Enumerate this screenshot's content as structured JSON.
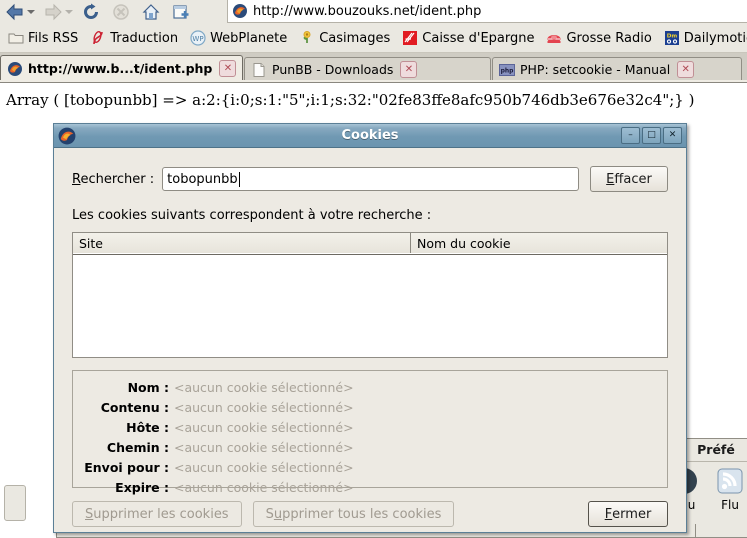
{
  "browser": {
    "nav": {
      "back": "back-arrow",
      "back_menu": "back-dropdown",
      "forward": "forward-arrow",
      "forward_menu": "forward-dropdown",
      "reload": "reload-icon",
      "stop": "stop-icon",
      "home": "home-icon",
      "newtab": "new-tab-icon"
    },
    "url": {
      "value": "http://www.bouzouks.net/ident.php",
      "favicon": "firefox-favicon"
    },
    "bookmarks": [
      {
        "label": "Fils RSS",
        "icon": "folder-icon"
      },
      {
        "label": "Traduction",
        "icon": "traduction-icon"
      },
      {
        "label": "WebPlanete",
        "icon": "webplanete-icon"
      },
      {
        "label": "Casimages",
        "icon": "casimages-icon"
      },
      {
        "label": "Caisse d'Epargne",
        "icon": "caisse-epargne-icon"
      },
      {
        "label": "Grosse Radio",
        "icon": "grosse-radio-icon"
      },
      {
        "label": "Dailymotion",
        "icon": "dailymotion-icon"
      }
    ],
    "tabs": [
      {
        "label": "http://www.b...t/ident.php",
        "icon": "firefox-favicon",
        "active": true,
        "close": "✕"
      },
      {
        "label": "PunBB - Downloads",
        "icon": "page-icon",
        "active": false,
        "close": "✕"
      },
      {
        "label": "PHP: setcookie - Manual",
        "icon": "php-icon",
        "active": false,
        "close": "✕"
      }
    ],
    "page_text": "Array ( [tobopunbb] => a:2:{i:0;s:1:\"5\";i:1;s:32:\"02fe83ffe8afc950b746db3e676e32c4\";} )"
  },
  "prefs_window": {
    "title": "Préfé",
    "cells": [
      {
        "label": "enu",
        "icon": "menu-icon"
      },
      {
        "label": "Flu",
        "icon": "feed-icon"
      }
    ]
  },
  "dialog": {
    "title": "Cookies",
    "icon": "firefox-icon",
    "window_buttons": {
      "minimize": "–",
      "maximize": "□",
      "close": "✕"
    },
    "search": {
      "label_prefix": "R",
      "label_rest": "echercher :",
      "value": "tobopunbb",
      "placeholder": "",
      "clear_prefix": "E",
      "clear_rest": "ffacer"
    },
    "hint": "Les cookies suivants correspondent à votre recherche :",
    "list": {
      "columns": [
        "Site",
        "Nom du cookie"
      ],
      "rows": []
    },
    "details": {
      "empty_value": "<aucun cookie sélectionné>",
      "fields": [
        {
          "label": "Nom :",
          "value": "<aucun cookie sélectionné>"
        },
        {
          "label": "Contenu :",
          "value": "<aucun cookie sélectionné>"
        },
        {
          "label": "Hôte :",
          "value": "<aucun cookie sélectionné>"
        },
        {
          "label": "Chemin :",
          "value": "<aucun cookie sélectionné>"
        },
        {
          "label": "Envoi pour :",
          "value": "<aucun cookie sélectionné>"
        },
        {
          "label": "Expire :",
          "value": "<aucun cookie sélectionné>"
        }
      ]
    },
    "buttons": {
      "delete_prefix": "S",
      "delete_rest": "upprimer les cookies",
      "delete_all_prefix": "S",
      "delete_all_mid": "u",
      "delete_all_rest": "pprimer tous les cookies",
      "close_prefix": "F",
      "close_rest": "ermer"
    }
  },
  "colors": {
    "titlebar": "#7099b3",
    "dialog_bg": "#edeae3",
    "chrome_bg": "#eae8e1",
    "tabstrip_bg": "#cfccc3",
    "disabled_text": "#a09a90",
    "placeholder_text": "#a9a399"
  }
}
